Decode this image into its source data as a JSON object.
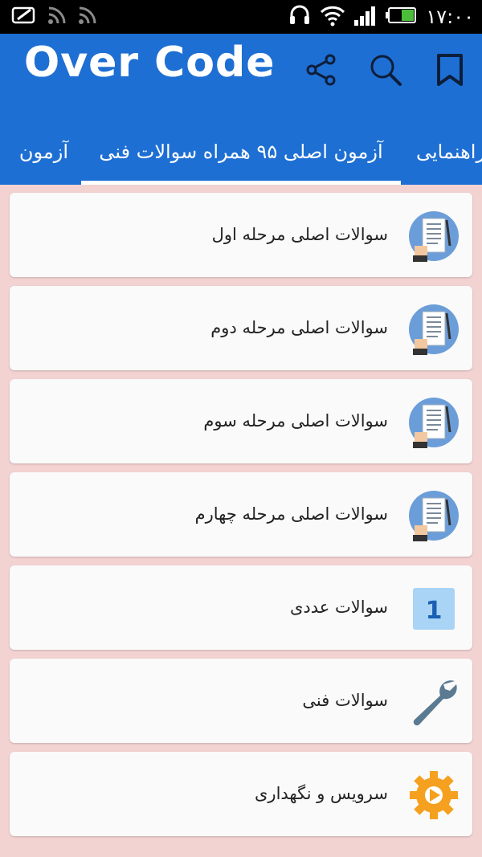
{
  "status_bar": {
    "time": "۱۷:۰۰"
  },
  "app_bar": {
    "logo": "Over Code",
    "actions": [
      {
        "name": "share-button",
        "icon": "share-icon"
      },
      {
        "name": "search-button",
        "icon": "search-icon"
      },
      {
        "name": "bookmark-button",
        "icon": "bookmark-icon"
      }
    ]
  },
  "tabs": [
    {
      "label": "راهنمایی"
    },
    {
      "label": "آزمون اصلی ۹۵ همراه سوالات فنی",
      "selected": true
    },
    {
      "label": "آزمون"
    }
  ],
  "items": [
    {
      "label": "سوالات اصلی  مرحله اول",
      "icon": "checklist-icon"
    },
    {
      "label": "سوالات اصلی  مرحله دوم",
      "icon": "checklist-icon"
    },
    {
      "label": "سوالات اصلی  مرحله سوم",
      "icon": "checklist-icon"
    },
    {
      "label": "سوالات اصلی  مرحله چهارم",
      "icon": "checklist-icon"
    },
    {
      "label": "سوالات عددی",
      "icon": "number-one-icon",
      "badge": "1"
    },
    {
      "label": "سوالات فنی",
      "icon": "wrench-icon"
    },
    {
      "label": "سرویس و نگهداری",
      "icon": "gear-icon"
    }
  ],
  "colors": {
    "primary": "#1e6fd3",
    "background": "#f3d2d2",
    "card": "#fafafa",
    "icon_circle": "#6b9ed9",
    "gear": "#f5a01e"
  }
}
